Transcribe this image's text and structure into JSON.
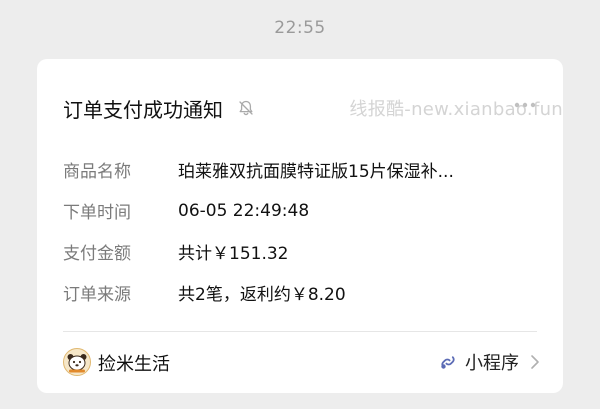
{
  "timestamp": "22:55",
  "card": {
    "title": "订单支付成功通知",
    "watermark": "线报酷-new.xianbao.fun",
    "fields": [
      {
        "label": "商品名称",
        "value": "珀莱雅双抗面膜特证版15片保湿补..."
      },
      {
        "label": "下单时间",
        "value": "06-05 22:49:48"
      },
      {
        "label": "支付金额",
        "value": "共计￥151.32"
      },
      {
        "label": "订单来源",
        "value": "共2笔，返利约￥8.20"
      }
    ]
  },
  "footer": {
    "app_name": "捡米生活",
    "mini_program_label": "小程序"
  },
  "colors": {
    "background": "#ededed",
    "card": "#ffffff",
    "label": "#7b7b7b",
    "text": "#111111",
    "link_icon": "#5b6bb5"
  },
  "icons": [
    "bell-muted-icon",
    "more-icon",
    "app-logo-icon",
    "mini-program-link-icon",
    "chevron-right-icon"
  ]
}
